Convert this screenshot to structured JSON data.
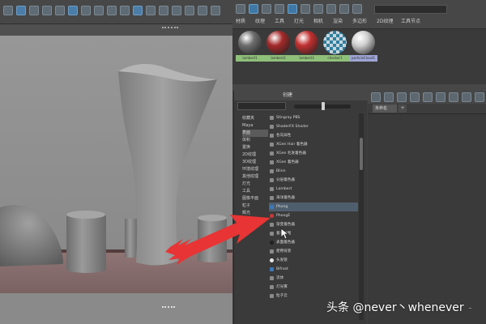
{
  "viewport": {
    "name": "3d-viewport"
  },
  "hypershade": {
    "tabs": [
      "材质",
      "纹理",
      "工具",
      "灯光",
      "相机",
      "渲染",
      "多边形",
      "2D纹理",
      "工具节点"
    ],
    "swatches": [
      {
        "label": "lambert1",
        "color": "#6e6e6e",
        "label_bg": "#8fc07a"
      },
      {
        "label": "lambert2",
        "color": "#a52a2a",
        "label_bg": "#8fc07a"
      },
      {
        "label": "lambert3",
        "color": "#c23030",
        "label_bg": "#8fc07a"
      },
      {
        "label": "checker1",
        "color": "#3b8dad",
        "label_bg": "#8fc07a"
      },
      {
        "label": "particleCloud1",
        "color": "#d0d0d0",
        "label_bg": "#9fa6d6"
      }
    ]
  },
  "create_panel": {
    "title": "创建",
    "categories": [
      {
        "label": "收藏夹",
        "selected": false
      },
      {
        "label": "Maya",
        "selected": false
      },
      {
        "label": "表面",
        "selected": true
      },
      {
        "label": "体积",
        "selected": false
      },
      {
        "label": "置换",
        "selected": false
      },
      {
        "label": "2D纹理",
        "selected": false
      },
      {
        "label": "3D纹理",
        "selected": false
      },
      {
        "label": "环境纹理",
        "selected": false
      },
      {
        "label": "其他纹理",
        "selected": false
      },
      {
        "label": "灯光",
        "selected": false
      },
      {
        "label": "工具",
        "selected": false
      },
      {
        "label": "图像平面",
        "selected": false
      },
      {
        "label": "粒子",
        "selected": false
      },
      {
        "label": "辉光",
        "selected": false
      },
      {
        "label": "Rendering",
        "selected": false
      }
    ],
    "nodes": [
      {
        "label": "Stingray PBS",
        "icon": "default",
        "highlight": false
      },
      {
        "label": "ShaderFX Shader",
        "icon": "default",
        "highlight": false
      },
      {
        "label": "各向异性",
        "icon": "default",
        "highlight": false
      },
      {
        "label": "XGen Hair 着色器",
        "icon": "default",
        "highlight": false
      },
      {
        "label": "XGen 毛发着色器",
        "icon": "default",
        "highlight": false
      },
      {
        "label": "XGen 着色器",
        "icon": "default",
        "highlight": false
      },
      {
        "label": "Blinn",
        "icon": "default",
        "highlight": false
      },
      {
        "label": "分层着色器",
        "icon": "default",
        "highlight": false
      },
      {
        "label": "Lambert",
        "icon": "default",
        "highlight": false
      },
      {
        "label": "海洋着色器",
        "icon": "default",
        "highlight": false
      },
      {
        "label": "Phong",
        "icon": "blue",
        "highlight": true
      },
      {
        "label": "PhongE",
        "icon": "red",
        "highlight": false
      },
      {
        "label": "渐变着色器",
        "icon": "default",
        "highlight": false
      },
      {
        "label": "着色贴图",
        "icon": "default",
        "highlight": false
      },
      {
        "label": "表面着色器",
        "icon": "dark",
        "highlight": false
      },
      {
        "label": "使用背景",
        "icon": "default",
        "highlight": false
      },
      {
        "label": "头发管",
        "icon": "white",
        "highlight": false
      },
      {
        "label": "Bifrost",
        "icon": "blue",
        "highlight": false
      },
      {
        "label": "流体",
        "icon": "default",
        "highlight": false
      },
      {
        "label": "灯光雾",
        "icon": "default",
        "highlight": false
      },
      {
        "label": "粒子云",
        "icon": "default",
        "highlight": false
      }
    ]
  },
  "graph_panel": {
    "tab_label": "未命名",
    "add_tab": "+"
  },
  "watermark": {
    "text": "头条 @never丶whenever"
  },
  "colors": {
    "arrow": "#e83434",
    "selection": "#4f5e6d"
  }
}
